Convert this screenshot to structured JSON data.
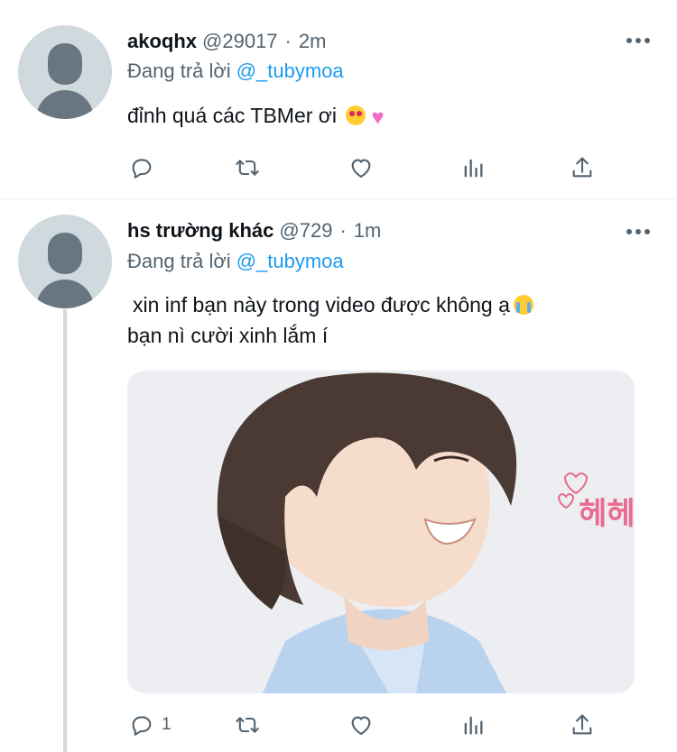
{
  "tweets": [
    {
      "name": "akoqhx",
      "handle": "@29017",
      "separator": "·",
      "time": "2m",
      "reply_prefix": "Đang trả lời",
      "reply_to": "@_tubymoa",
      "text": "đỉnh quá các TBMer ơi",
      "reply_count": ""
    },
    {
      "name": "hs trường khác",
      "handle": "@729",
      "separator": "·",
      "time": "1m",
      "reply_prefix": "Đang trả lời",
      "reply_to": "@_tubymoa",
      "text_line1": "xin inf bạn này trong video được không ạ",
      "text_line2": "bạn nì cười xinh lắm í",
      "reply_count": "1",
      "media_overlay_text": "헤헤"
    }
  ],
  "colors": {
    "link": "#1d9bf0",
    "secondary_text": "#536471",
    "avatar_bg": "#cfd9de",
    "divider": "#e6ecf0"
  },
  "icons": [
    "reply-icon",
    "retweet-icon",
    "like-icon",
    "stats-icon",
    "share-icon",
    "more-icon",
    "heart-eyes-emoji",
    "pink-heart-emoji",
    "crying-emoji"
  ]
}
